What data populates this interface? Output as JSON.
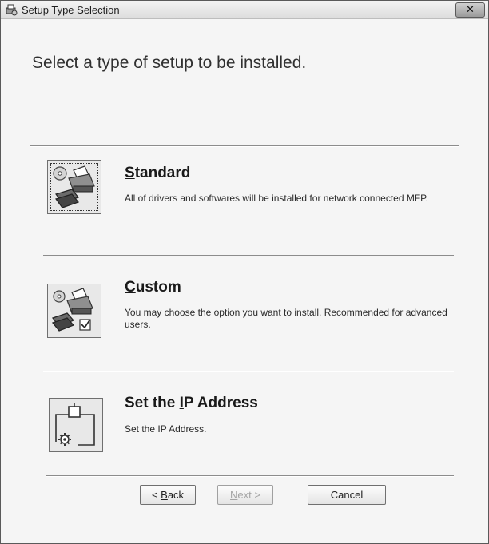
{
  "window": {
    "title": "Setup Type Selection",
    "close_symbol": "✕"
  },
  "heading": "Select a type of setup to be installed.",
  "options": [
    {
      "title_mnemonic": "S",
      "title_rest": "tandard",
      "description": "All of drivers and softwares will be installed for network connected MFP.",
      "icon": "printer-scanner-disc-icon"
    },
    {
      "title_mnemonic": "C",
      "title_rest": "ustom",
      "description": "You may choose the option you want to install. Recommended for advanced users.",
      "icon": "printer-scanner-checkbox-icon"
    },
    {
      "title_before": "Set the ",
      "title_mnemonic": "I",
      "title_rest": "P Address",
      "description": "Set the IP Address.",
      "icon": "network-settings-icon"
    }
  ],
  "buttons": {
    "back_prefix": "< ",
    "back_mnemonic": "B",
    "back_rest": "ack",
    "next_mnemonic": "N",
    "next_rest": "ext >",
    "next_enabled": false,
    "cancel_label": "Cancel"
  }
}
